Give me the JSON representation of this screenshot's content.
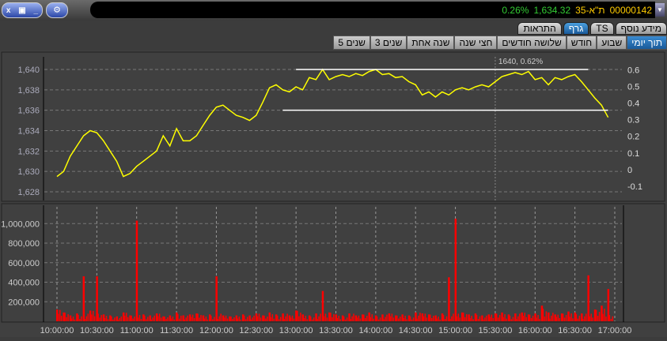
{
  "window": {
    "close": "x",
    "restore": "▣",
    "minimize": "_",
    "app_icon": "⚙"
  },
  "ticker": {
    "id": "00000142",
    "name": "ת\"א-35",
    "price": "1,634.32",
    "change": "0.26%",
    "dropdown": "▼"
  },
  "tabs": [
    {
      "label": "מידע נוסף"
    },
    {
      "label": "TS"
    },
    {
      "label": "גרף",
      "active": true
    },
    {
      "label": "התראות"
    }
  ],
  "periods": [
    {
      "label": "תוך יומי",
      "active": true
    },
    {
      "label": "שבוע"
    },
    {
      "label": "חודש"
    },
    {
      "label": "שלושה חודשים"
    },
    {
      "label": "חצי שנה"
    },
    {
      "label": "שנה אחת"
    },
    {
      "label": "3 שנים"
    },
    {
      "label": "5 שנים"
    }
  ],
  "colors": {
    "price": "#ffff00",
    "volume": "#ff0000",
    "accent": "#1a6fb5"
  },
  "chart_data": [
    {
      "type": "line",
      "title": "price",
      "ylim": [
        1627.5,
        1640.5
      ],
      "y_ticks": [
        "1,628",
        "1,630",
        "1,632",
        "1,634",
        "1,636",
        "1,638",
        "1,640"
      ],
      "y_tick_values": [
        1628,
        1630,
        1632,
        1634,
        1636,
        1638,
        1640
      ],
      "right_ticks": [
        "-0.1",
        "0",
        "0.1",
        "0.2",
        "0.3",
        "0.4",
        "0.5",
        "0.6"
      ],
      "annotation": "1640, 0.62%",
      "annotation_time": "15:30",
      "lines": [
        {
          "from": "13:00",
          "to": "16:40",
          "value": 1640
        },
        {
          "from": "12:50",
          "to": "16:55",
          "value": 1636
        }
      ],
      "start": "10:00",
      "interval_min": 5,
      "values": [
        1629.5,
        1630,
        1631.5,
        1632.5,
        1633.5,
        1634,
        1633.8,
        1633,
        1632,
        1631,
        1629.5,
        1629.8,
        1630.5,
        1631,
        1631.5,
        1632,
        1633.5,
        1632.5,
        1634.2,
        1633,
        1633,
        1633.5,
        1634.5,
        1635.5,
        1636.3,
        1636.5,
        1636,
        1635.5,
        1635.3,
        1635,
        1635.5,
        1636.8,
        1638.2,
        1638.5,
        1638,
        1637.8,
        1638.3,
        1638,
        1639.2,
        1639,
        1640,
        1639,
        1639.3,
        1639.5,
        1639.3,
        1639.6,
        1639.4,
        1639.8,
        1640,
        1639.5,
        1639.6,
        1639.2,
        1639.3,
        1638.8,
        1638.5,
        1637.5,
        1637.8,
        1637.3,
        1637.8,
        1637.5,
        1638,
        1638.2,
        1638,
        1638.3,
        1638.5,
        1638.3,
        1638.8,
        1639.3,
        1639.5,
        1639.7,
        1639.5,
        1639.8,
        1639,
        1639.2,
        1638.5,
        1639.2,
        1639,
        1639.3,
        1639.5,
        1638.8,
        1638,
        1637.2,
        1636.5,
        1635.3
      ]
    },
    {
      "type": "bar",
      "title": "volume",
      "ylim": [
        0,
        1250000
      ],
      "y_ticks": [
        "200,000",
        "400,000",
        "600,000",
        "800,000",
        "1,000,000"
      ],
      "y_tick_values": [
        200000,
        400000,
        600000,
        800000,
        1000000
      ],
      "x_ticks": [
        "10:00:00",
        "10:30:00",
        "11:00:00",
        "11:30:00",
        "12:00:00",
        "12:30:00",
        "13:00:00",
        "13:30:00",
        "14:00:00",
        "14:30:00",
        "15:00:00",
        "15:30:00",
        "16:00:00",
        "16:30:00",
        "17:00:00"
      ],
      "start": "10:00",
      "interval_min": 5,
      "values": [
        120000,
        90000,
        60000,
        80000,
        460000,
        110000,
        460000,
        70000,
        60000,
        50000,
        90000,
        60000,
        1030000,
        70000,
        60000,
        80000,
        50000,
        60000,
        90000,
        60000,
        70000,
        80000,
        60000,
        70000,
        460000,
        60000,
        50000,
        60000,
        70000,
        60000,
        80000,
        60000,
        90000,
        70000,
        80000,
        60000,
        110000,
        70000,
        60000,
        80000,
        310000,
        90000,
        70000,
        60000,
        80000,
        60000,
        70000,
        90000,
        60000,
        70000,
        80000,
        60000,
        70000,
        60000,
        90000,
        80000,
        70000,
        60000,
        80000,
        450000,
        1050000,
        90000,
        70000,
        80000,
        60000,
        70000,
        80000,
        90000,
        70000,
        80000,
        90000,
        70000,
        80000,
        160000,
        90000,
        70000,
        80000,
        100000,
        90000,
        80000,
        470000,
        120000,
        160000,
        330000
      ]
    }
  ]
}
